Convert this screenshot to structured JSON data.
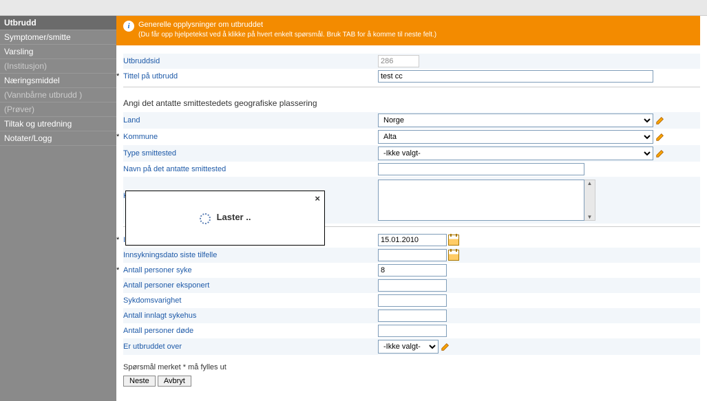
{
  "sidebar": {
    "items": [
      {
        "label": "Utbrudd",
        "active": true
      },
      {
        "label": "Symptomer/smitte"
      },
      {
        "label": "Varsling"
      },
      {
        "label": "(Institusjon)",
        "dim": true
      },
      {
        "label": "Næringsmiddel"
      },
      {
        "label": "(Vannbårne utbrudd )",
        "dim": true
      },
      {
        "label": "(Prøver)",
        "dim": true
      },
      {
        "label": "Tiltak og utredning"
      },
      {
        "label": "Notater/Logg"
      }
    ]
  },
  "banner": {
    "title": "Generelle opplysninger om utbruddet",
    "sub": "(Du får opp hjelpetekst ved å klikke på hvert enkelt spørsmål. Bruk TAB for å komme til neste felt.)"
  },
  "fields": {
    "utbruddsid_label": "Utbruddsid",
    "utbruddsid_value": "286",
    "tittel_label": "Tittel på utbrudd",
    "tittel_value": "test cc",
    "section_geo": "Angi det antatte smittestedets geografiske plassering",
    "land_label": "Land",
    "land_value": "Norge",
    "kommune_label": "Kommune",
    "kommune_value": "Alta",
    "type_label": "Type smittested",
    "type_value": "-Ikke valgt-",
    "navn_label": "Navn på det antatte smittested",
    "navn_value": "",
    "kommentar_label": "Kommentar til sm",
    "kommentar_value": "",
    "innsyk1_label": "Innsykningsdato",
    "innsyk1_value": "15.01.2010",
    "innsyk2_label": "Innsykningsdato siste tilfelle",
    "innsyk2_value": "",
    "antall_syke_label": "Antall personer syke",
    "antall_syke_value": "8",
    "antall_eksp_label": "Antall personer eksponert",
    "antall_eksp_value": "",
    "sykdom_label": "Sykdomsvarighet",
    "sykdom_value": "",
    "innlagt_label": "Antall innlagt sykehus",
    "innlagt_value": "",
    "dode_label": "Antall personer døde",
    "dode_value": "",
    "over_label": "Er utbruddet over",
    "over_value": "-Ikke valgt-"
  },
  "footer": {
    "note": "Spørsmål merket * må fylles ut",
    "next": "Neste",
    "cancel": "Avbryt"
  },
  "modal": {
    "text": "Laster .."
  }
}
